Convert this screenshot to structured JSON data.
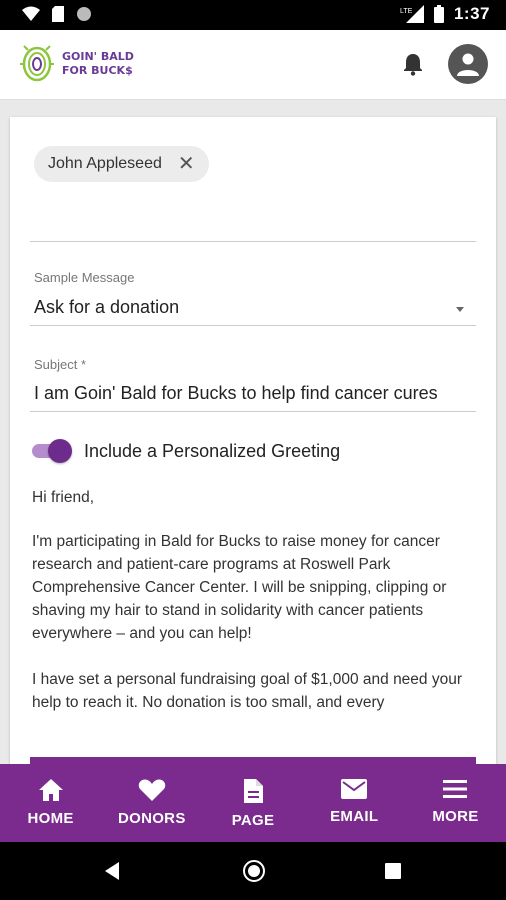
{
  "status_bar": {
    "time": "1:37"
  },
  "app_bar": {
    "logo_line1": "GOIN' BALD",
    "logo_line2": "FOR BUCK$"
  },
  "form": {
    "recipient_chip": "John Appleseed",
    "sample_message_label": "Sample Message",
    "sample_message_value": "Ask for a donation",
    "subject_label": "Subject *",
    "subject_value": "I am Goin' Bald for Bucks to help find cancer cures",
    "toggle_label": "Include a Personalized Greeting",
    "toggle_on": true,
    "greeting": "Hi friend,",
    "paragraph1": "I'm participating in Bald for Bucks to raise money for cancer research and patient-care programs at Roswell Park Comprehensive Cancer Center. I will be snipping, clipping or shaving my hair to stand in solidarity with cancer patients everywhere – and you can help!",
    "paragraph2": "I have set a personal fundraising goal of $1,000 and need your help to reach it. No donation is too small, and every"
  },
  "bottom_nav": {
    "items": [
      {
        "label": "HOME",
        "icon": "home-icon"
      },
      {
        "label": "DONORS",
        "icon": "heart-icon"
      },
      {
        "label": "PAGE",
        "icon": "page-icon"
      },
      {
        "label": "EMAIL",
        "icon": "email-icon"
      },
      {
        "label": "MORE",
        "icon": "menu-icon"
      }
    ]
  },
  "colors": {
    "brand_purple": "#7b2a8e",
    "logo_green": "#8cc63f"
  }
}
